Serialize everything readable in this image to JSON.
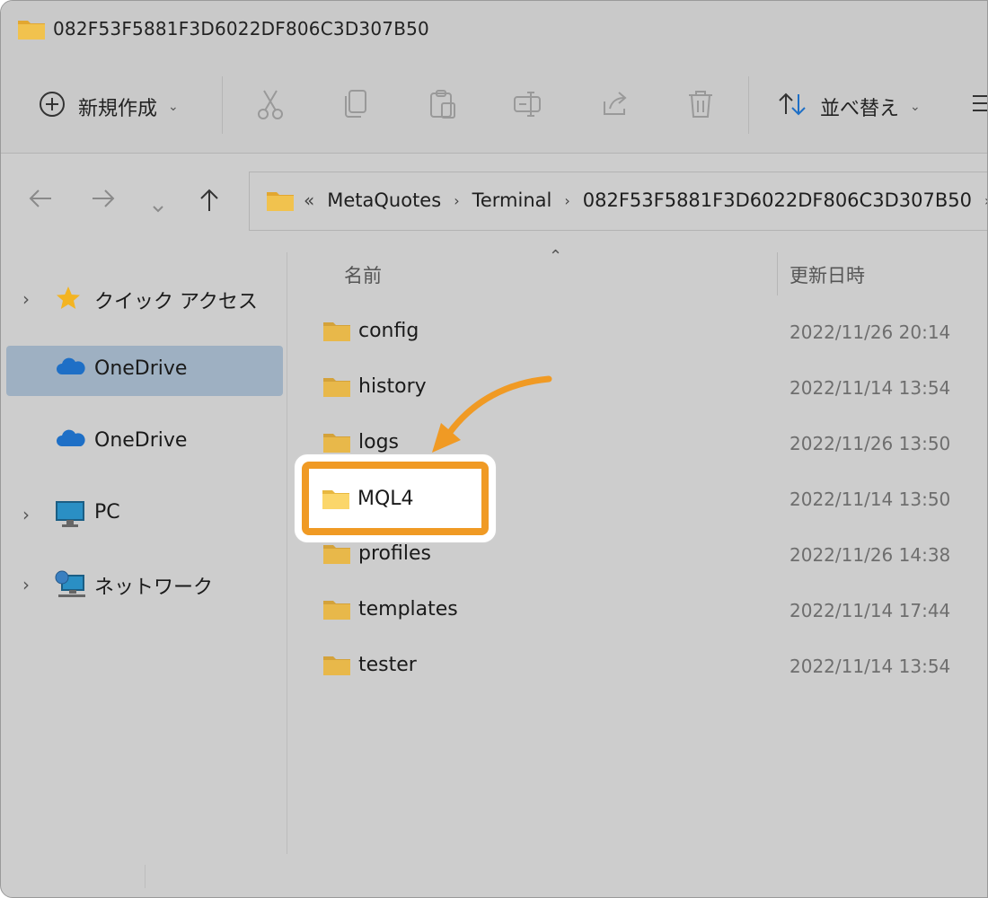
{
  "window": {
    "title": "082F53F5881F3D6022DF806C3D307B50"
  },
  "toolbar": {
    "new_label": "新規作成",
    "sort_label": "並べ替え",
    "icons": [
      "plus-circle-icon",
      "cut-icon",
      "copy-icon",
      "paste-icon",
      "rename-icon",
      "share-icon",
      "delete-icon",
      "sort-icon",
      "more-icon"
    ]
  },
  "address": {
    "overflow": "«",
    "crumbs": [
      "MetaQuotes",
      "Terminal",
      "082F53F5881F3D6022DF806C3D307B50"
    ]
  },
  "sidebar": {
    "items": [
      {
        "label": "クイック アクセス",
        "icon": "star-icon"
      },
      {
        "label": "OneDrive",
        "icon": "cloud-icon",
        "selected": true
      },
      {
        "label": "OneDrive",
        "icon": "cloud-icon"
      },
      {
        "label": "PC",
        "icon": "monitor-icon"
      },
      {
        "label": "ネットワーク",
        "icon": "network-icon"
      }
    ]
  },
  "columns": {
    "name": "名前",
    "modified": "更新日時"
  },
  "files": [
    {
      "name": "config",
      "date": "2022/11/26 20:14"
    },
    {
      "name": "history",
      "date": "2022/11/14 13:54"
    },
    {
      "name": "logs",
      "date": "2022/11/26 13:50"
    },
    {
      "name": "MQL4",
      "date": "2022/11/14 13:50",
      "highlighted": true
    },
    {
      "name": "profiles",
      "date": "2022/11/26 14:38"
    },
    {
      "name": "templates",
      "date": "2022/11/14 17:44"
    },
    {
      "name": "tester",
      "date": "2022/11/14 13:54"
    }
  ],
  "colors": {
    "highlight": "#f09a24",
    "folder": "#e8b84a",
    "selection": "#9eb0c2",
    "onedrive": "#1e6fc6"
  }
}
